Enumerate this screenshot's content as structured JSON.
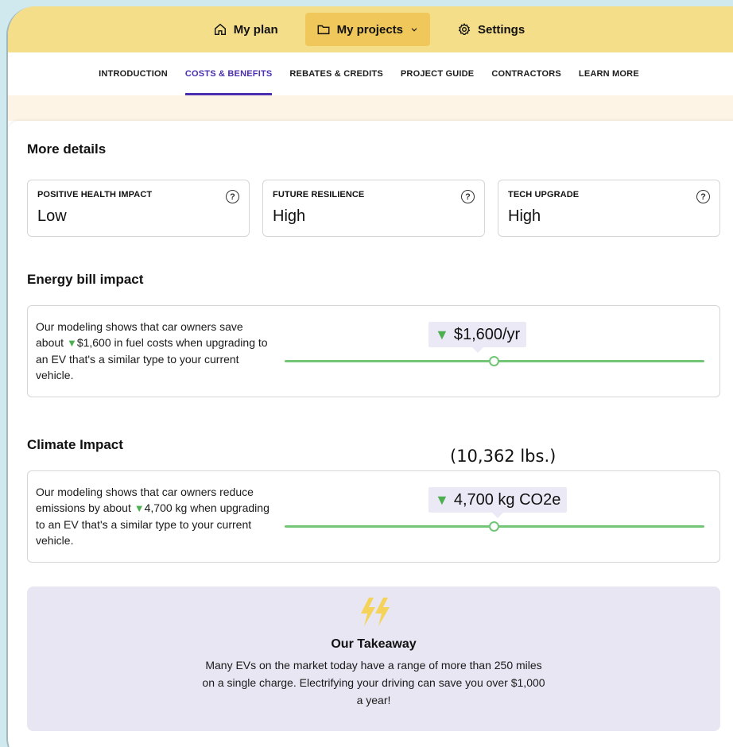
{
  "topnav": [
    {
      "label": "My plan",
      "icon": "home-icon"
    },
    {
      "label": "My projects",
      "icon": "folder-icon",
      "active": true
    },
    {
      "label": "Settings",
      "icon": "gear-icon"
    }
  ],
  "subtabs": [
    "INTRODUCTION",
    "COSTS & BENEFITS",
    "REBATES & CREDITS",
    "PROJECT GUIDE",
    "CONTRACTORS",
    "LEARN MORE"
  ],
  "active_subtab": "COSTS & BENEFITS",
  "more_details": {
    "title": "More details",
    "cards": [
      {
        "label": "POSITIVE HEALTH IMPACT",
        "value": "Low"
      },
      {
        "label": "FUTURE RESILIENCE",
        "value": "High"
      },
      {
        "label": "TECH UPGRADE",
        "value": "High"
      }
    ]
  },
  "energy": {
    "title": "Energy bill impact",
    "text_pre": "Our modeling shows that car owners save about ",
    "text_amount": "$1,600",
    "text_post": " in fuel costs when upgrading to an EV that's a similar type to your current vehicle.",
    "bubble": "$1,600/yr"
  },
  "climate": {
    "title": "Climate Impact",
    "annotation": "(10,362 lbs.)",
    "text_pre": "Our modeling shows that car owners reduce emissions by about ",
    "text_amount": "4,700 kg",
    "text_post": " when upgrading to an EV that's a similar type to your current vehicle.",
    "bubble": "4,700 kg CO2e"
  },
  "takeaway": {
    "title": "Our Takeaway",
    "body": "Many EVs on the market today have a range of more than 250 miles on a single charge. Electrifying your driving can save you over $1,000 a year!"
  },
  "colors": {
    "topbar": "#f5de8a",
    "active_tab": "#4b2fb0",
    "slider": "#72c676",
    "takeaway_bg": "#e8e6f3",
    "decrease": "#4caf50"
  }
}
